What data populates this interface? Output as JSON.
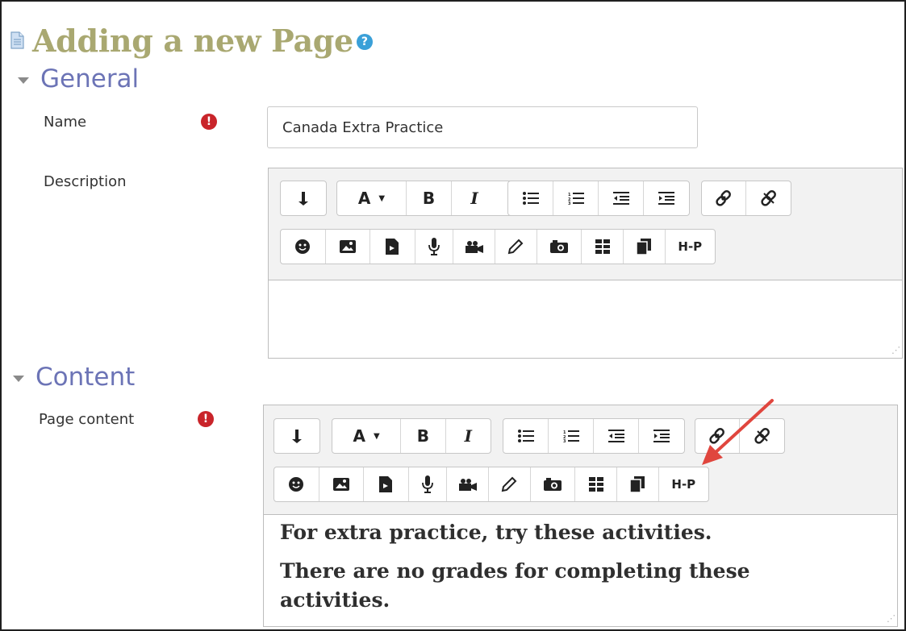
{
  "page": {
    "title": "Adding a new Page",
    "help_icon": "question-circle-icon"
  },
  "sections": {
    "general": "General",
    "content": "Content"
  },
  "fields": {
    "name": {
      "label": "Name",
      "value": "Canada Extra Practice",
      "required_icon": "exclamation-circle-icon"
    },
    "description": {
      "label": "Description"
    },
    "page_content": {
      "label": "Page content",
      "required_icon": "exclamation-circle-icon",
      "paragraphs": [
        "For extra practice, try these activities.",
        "There are no grades for completing these",
        "activities."
      ]
    }
  },
  "toolbar": {
    "row1": [
      "show-more-icon",
      "font-size-icon",
      "bold-icon",
      "italic-icon",
      "unordered-list-icon",
      "ordered-list-icon",
      "outdent-icon",
      "indent-icon",
      "link-icon",
      "unlink-icon"
    ],
    "row2": [
      "emoji-icon",
      "image-icon",
      "media-icon",
      "record-audio-icon",
      "record-video-icon",
      "draw-icon",
      "camera-icon",
      "table-icon",
      "copy-icon",
      "h5p-icon"
    ],
    "font_label": "A",
    "bold_label": "B",
    "italic_label": "I",
    "h5p_label": "H-P"
  },
  "colors": {
    "title": "#a9a871",
    "section": "#6c74b6",
    "required": "#c9242a",
    "help": "#3aa0d8",
    "arrow": "#e0463e"
  }
}
